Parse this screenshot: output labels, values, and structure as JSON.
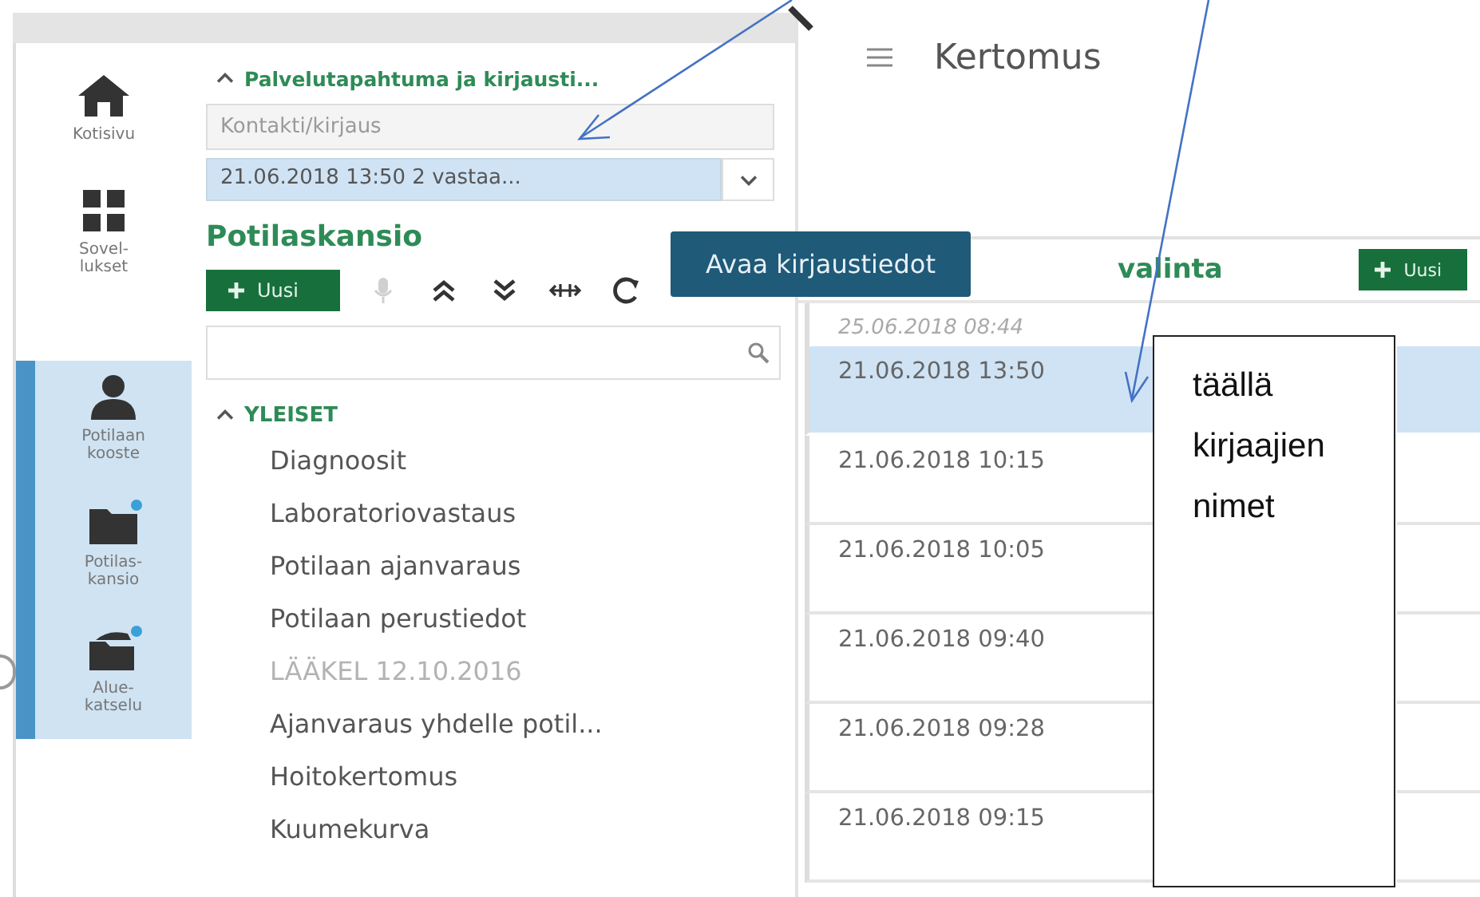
{
  "rail": {
    "items": [
      {
        "label": "Kotisivu",
        "kind": "home",
        "highlighted": false,
        "notification": false
      },
      {
        "label": "Sovel-lukset",
        "kind": "apps",
        "highlighted": false,
        "notification": false
      },
      {
        "label": "Potilaan kooste",
        "kind": "person",
        "highlighted": true,
        "notification": false
      },
      {
        "label": "Potilas-kansio",
        "kind": "folder",
        "highlighted": true,
        "notification": true
      },
      {
        "label": "Alue-katselu",
        "kind": "open-folder",
        "highlighted": true,
        "notification": true
      }
    ]
  },
  "panel": {
    "section": {
      "title": "Palvelutapahtuma ja kirjausti...",
      "expanded": true
    },
    "contact_field": {
      "placeholder": "Kontakti/kirjaus"
    },
    "record_select": {
      "value": "21.06.2018 13:50 2 vastaa..."
    },
    "title": "Potilaskansio",
    "new_button": "Uusi",
    "tools": [
      {
        "kind": "mic",
        "disabled": true
      },
      {
        "kind": "collapse-all",
        "disabled": false
      },
      {
        "kind": "expand-all",
        "disabled": false
      },
      {
        "kind": "fit",
        "disabled": false
      },
      {
        "kind": "refresh",
        "disabled": false
      }
    ],
    "group": {
      "title": "YLEISET",
      "expanded": true,
      "items": [
        {
          "label": "Diagnoosit",
          "disabled": false
        },
        {
          "label": "Laboratoriovastaus",
          "disabled": false
        },
        {
          "label": "Potilaan ajanvaraus",
          "disabled": false
        },
        {
          "label": "Potilaan perustiedot",
          "disabled": false
        },
        {
          "label": "LÄÄKEL 12.10.2016",
          "disabled": true
        },
        {
          "label": "Ajanvaraus yhdelle potil...",
          "disabled": false
        },
        {
          "label": "Hoitokertomus",
          "disabled": false
        },
        {
          "label": "Kuumekurva",
          "disabled": false
        }
      ]
    }
  },
  "main": {
    "title": "Kertomus",
    "list_title": "valinta",
    "new_button": "Uusi",
    "date_header": "25.06.2018 08:44",
    "rows": [
      {
        "time": "21.06.2018 13:50",
        "selected": true
      },
      {
        "time": "21.06.2018 10:15",
        "selected": false
      },
      {
        "time": "21.06.2018 10:05",
        "selected": false
      },
      {
        "time": "21.06.2018 09:40",
        "selected": false
      },
      {
        "time": "21.06.2018 09:28",
        "selected": false
      },
      {
        "time": "21.06.2018 09:15",
        "selected": false
      }
    ]
  },
  "tooltip": {
    "text": "Avaa kirjaustiedot"
  },
  "annotation": {
    "text": "täällä kirjaajien nimet"
  }
}
